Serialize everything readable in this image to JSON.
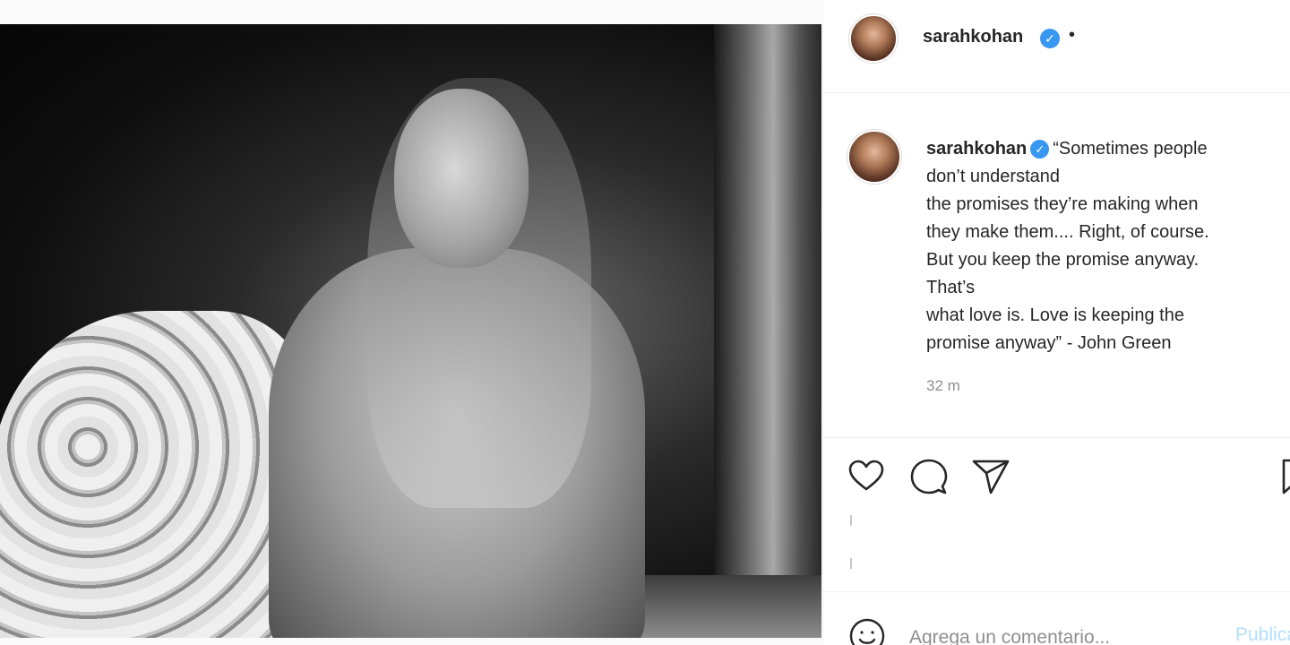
{
  "post": {
    "username": "sarahkohan",
    "verified_icon": "verified-badge-icon",
    "header_dot": "•",
    "caption_lines": [
      "“Sometimes people",
      "don’t understand",
      "the promises they’re making when",
      "they make them.... Right, of course.",
      "But you keep the promise anyway.",
      "That’s",
      "what love is. Love is keeping the",
      "promise anyway” - John Green"
    ],
    "timestamp": "32 m"
  },
  "actions": {
    "like_icon": "heart-icon",
    "comment_icon": "comment-icon",
    "share_icon": "paper-plane-icon",
    "save_icon": "bookmark-icon"
  },
  "comment_bar": {
    "emoji_icon": "smiley-icon",
    "placeholder": "Agrega un comentario...",
    "post_label": "Publicar"
  },
  "colors": {
    "verified": "#3897f0",
    "post_button_disabled": "#b2dffc",
    "secondary_text": "#8e8e8e"
  }
}
